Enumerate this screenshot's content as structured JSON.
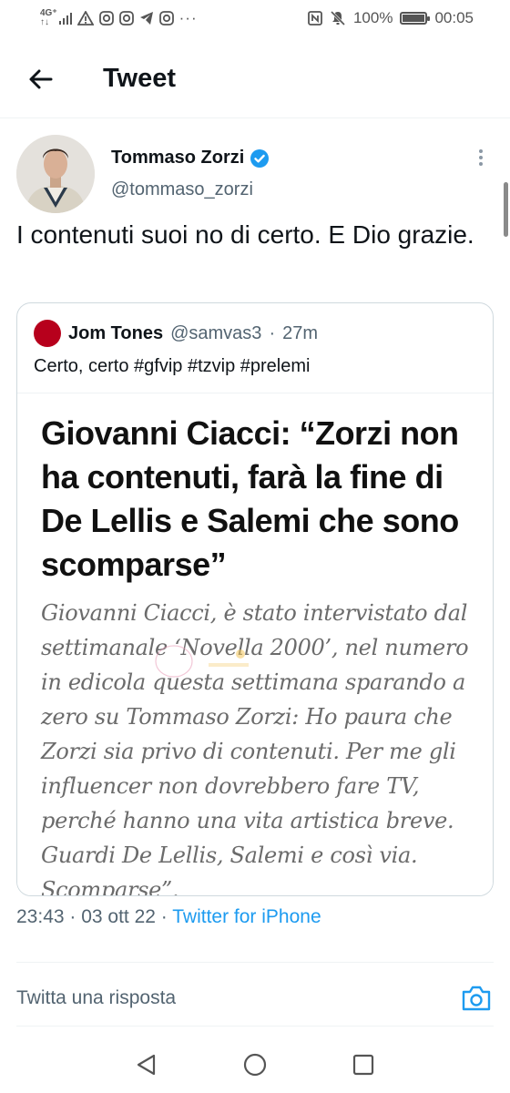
{
  "status_bar": {
    "network_top": "4G⁺",
    "network_bottom": "↑↓",
    "battery_percent_label": "100%",
    "battery_level": 1.0,
    "time": "00:05",
    "icons": [
      "signal-icon",
      "warning-icon",
      "instagram-icon",
      "instagram-icon",
      "telegram-icon",
      "instagram-icon",
      "more-notifications-icon",
      "nfc-icon",
      "mute-icon",
      "battery-icon"
    ]
  },
  "header": {
    "title": "Tweet"
  },
  "tweet": {
    "author_name": "Tommaso Zorzi",
    "author_handle": "@tommaso_zorzi",
    "text": "I contenuti suoi no di certo. E Dio grazie.",
    "timestamp": "23:43 · 03 ott 22 · ",
    "source": "Twitter for iPhone"
  },
  "quote": {
    "author_name": "Jom Tones",
    "author_handle": "@samvas3",
    "separator": "·",
    "time": "27m",
    "text": "Certo, certo #gfvip #tzvip #prelemi",
    "image": {
      "headline": "Giovanni Ciacci: “Zorzi non ha contenuti, farà la fine di De Lellis e Salemi che sono scomparse”",
      "body": "Giovanni Ciacci, è stato intervistato dal settimanale ‘Novella 2000’, nel numero in edicola questa settimana sparando a zero su Tommaso Zorzi: Ho paura che Zorzi sia privo di contenuti. Per me gli influencer non dovrebbero fare TV, perché hanno una vita artistica breve. Guardi De Lellis, Salemi e così via. Scomparse”."
    }
  },
  "reply": {
    "placeholder": "Twitta una risposta"
  },
  "colors": {
    "accent": "#1d9bf0",
    "text": "#0f1419",
    "secondary": "#536471",
    "quote_avatar": "#b7001c"
  }
}
